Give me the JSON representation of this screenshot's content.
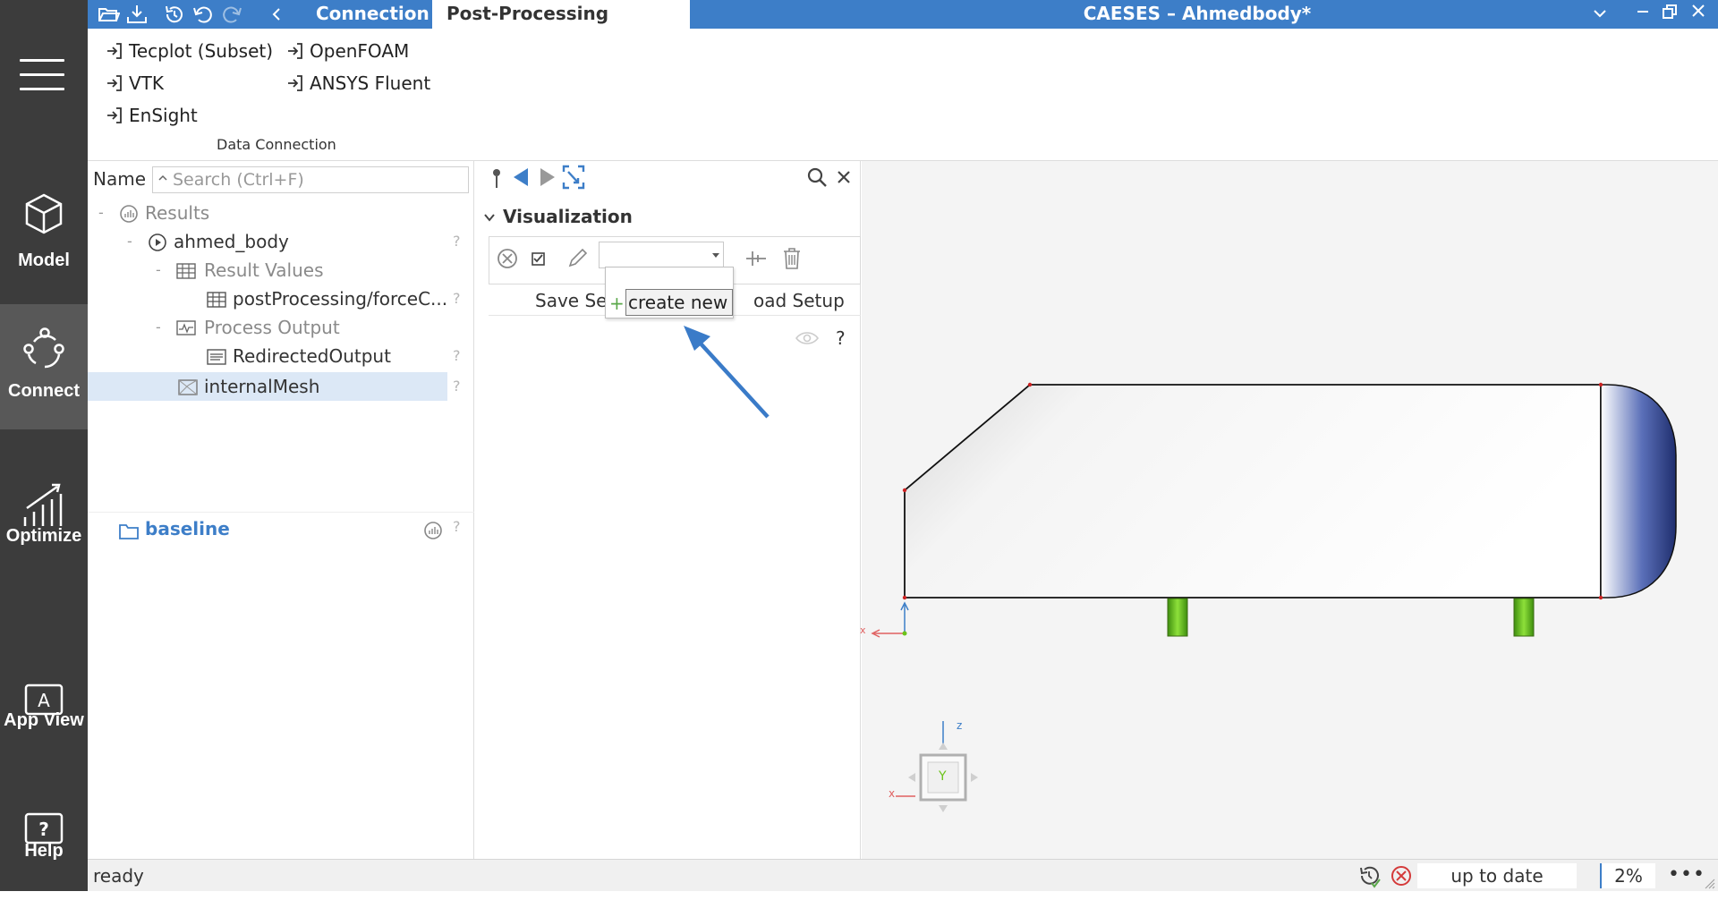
{
  "nav": {
    "items": [
      {
        "label": "Model"
      },
      {
        "label": "Connect"
      },
      {
        "label": "Optimize"
      },
      {
        "label": "App View"
      },
      {
        "label": "Help"
      }
    ]
  },
  "titlebar": {
    "tabs": [
      "Connection",
      "Post-Processing"
    ],
    "app_title": "CAESES  –  Ahmedbody*"
  },
  "ribbon": {
    "col1": [
      "Tecplot (Subset)",
      "VTK",
      "EnSight"
    ],
    "col2": [
      "OpenFOAM",
      "ANSYS Fluent"
    ],
    "group_label": "Data Connection"
  },
  "tree": {
    "name_label": "Name",
    "search_placeholder": "Search (Ctrl+F)",
    "rows": [
      {
        "label": "Results"
      },
      {
        "label": "ahmed_body"
      },
      {
        "label": "Result Values"
      },
      {
        "label": "postProcessing/forceC..."
      },
      {
        "label": "Process Output"
      },
      {
        "label": "RedirectedOutput"
      },
      {
        "label": "internalMesh"
      }
    ],
    "help_mark": "?",
    "collapse_mark": "-",
    "project": {
      "label": "baseline"
    }
  },
  "visualization": {
    "title": "Visualization",
    "combo_value": "",
    "save_label": "Save Set",
    "load_label": "oad Setup",
    "dropdown_item": "create new",
    "help_mark": "?"
  },
  "status": {
    "text": "ready",
    "state": "up to date",
    "zoom": "2%",
    "more": "•••"
  },
  "axes": {
    "x": "x",
    "z": "z",
    "cube_face": "Y"
  },
  "colors": {
    "accent": "#3d7ec8",
    "sidebar": "#3c3c3c",
    "legs": "#6bc31a",
    "nose_dark": "#1f2e6e",
    "arrow": "#3a7bc8"
  }
}
